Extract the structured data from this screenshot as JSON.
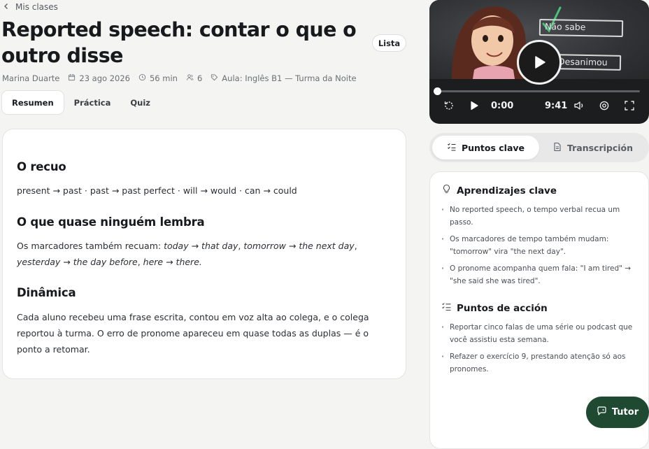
{
  "breadcrumb": {
    "label": "Mis clases"
  },
  "header": {
    "title": "Reported speech: contar o que o outro disse",
    "list_button": "Lista"
  },
  "meta": {
    "teacher": "Marina Duarte",
    "date": "23 ago 2026",
    "duration": "56 min",
    "participants": "6",
    "class": "Aula: Inglês B1 — Turma da Noite"
  },
  "tabs": [
    {
      "label": "Resumen",
      "active": true
    },
    {
      "label": "Práctica",
      "active": false
    },
    {
      "label": "Quiz",
      "active": false
    }
  ],
  "content": {
    "sec1": {
      "heading": "O recuo",
      "text": "present → past · past → past perfect · will → would · can → could"
    },
    "sec2": {
      "heading": "O que quase ninguém lembra",
      "intro": "Os marcadores também recuam: ",
      "i1": "today",
      "a1": " → ",
      "i2": "that day",
      "s1": ", ",
      "i3": "tomorrow",
      "a2": " → ",
      "i4": "the next day",
      "s2": ", ",
      "i5": "yesterday",
      "a3": " → ",
      "i6": "the day before",
      "s3": ", ",
      "i7": "here",
      "a4": " → ",
      "i8": "there."
    },
    "sec3": {
      "heading": "Dinâmica",
      "text": "Cada aluno recebeu uma frase escrita, contou em voz alta ao colega, e o colega reportou à turma. O erro de pronome apareceu em quase todas as duplas — é o ponto a retomar."
    }
  },
  "video": {
    "note_1": "Não sabe",
    "note_2": "Desanimou",
    "current_time": "0:00",
    "duration": "9:41",
    "progress": 0
  },
  "panel_tabs": [
    {
      "label": "Puntos clave",
      "active": true
    },
    {
      "label": "Transcripción",
      "active": false
    }
  ],
  "panel": {
    "learnings_title": "Aprendizajes clave",
    "learnings": [
      "No reported speech, o tempo verbal recua um passo.",
      "Os marcadores de tempo também mudam: \"tomorrow\" vira \"the next day\".",
      "O pronome acompanha quem fala: \"I am tired\" → \"she said she was tired\"."
    ],
    "actions_title": "Puntos de acción",
    "actions": [
      "Reportar cinco falas de uma série ou podcast que você assistiu esta semana.",
      "Refazer o exercício 9, prestando atenção só aos pronomes."
    ]
  },
  "tutor": {
    "label": "Tutor"
  },
  "colors": {
    "accent": "#1f4a31",
    "background": "#f4f4f3",
    "video_bg": "#1c1d1f"
  }
}
